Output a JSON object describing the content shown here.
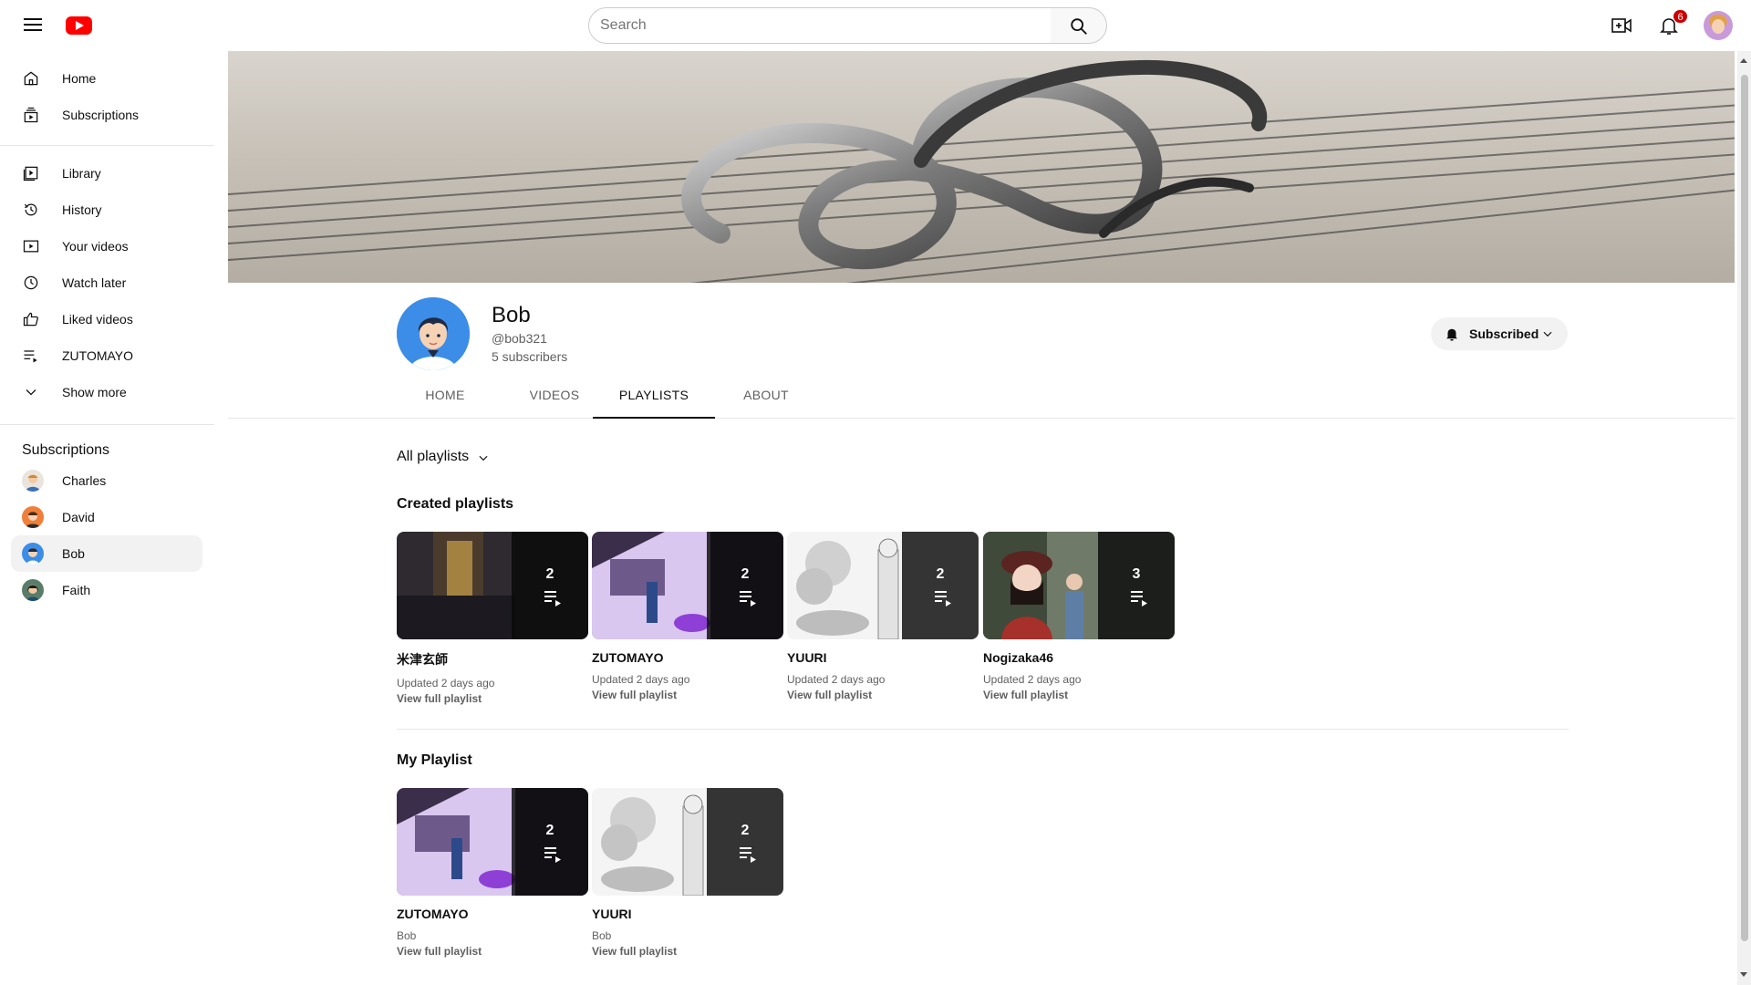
{
  "search": {
    "placeholder": "Search"
  },
  "notifications": {
    "count": "6"
  },
  "sidebar": {
    "main": [
      {
        "label": "Home",
        "icon": "home-icon"
      },
      {
        "label": "Subscriptions",
        "icon": "subscriptions-icon"
      }
    ],
    "library": [
      {
        "label": "Library",
        "icon": "library-icon"
      },
      {
        "label": "History",
        "icon": "history-icon"
      },
      {
        "label": "Your videos",
        "icon": "your-videos-icon"
      },
      {
        "label": "Watch later",
        "icon": "watch-later-icon"
      },
      {
        "label": "Liked videos",
        "icon": "thumbs-up-icon"
      },
      {
        "label": "ZUTOMAYO",
        "icon": "playlist-icon"
      },
      {
        "label": "Show more",
        "icon": "chevron-down-icon"
      }
    ],
    "subscriptions_heading": "Subscriptions",
    "subscriptions": [
      {
        "label": "Charles",
        "active": false
      },
      {
        "label": "David",
        "active": false
      },
      {
        "label": "Bob",
        "active": true
      },
      {
        "label": "Faith",
        "active": false
      }
    ]
  },
  "channel": {
    "name": "Bob",
    "handle": "@bob321",
    "subscribers": "5 subscribers",
    "subscribe_label": "Subscribed"
  },
  "tabs": [
    {
      "label": "HOME",
      "active": false
    },
    {
      "label": "VIDEOS",
      "active": false
    },
    {
      "label": "PLAYLISTS",
      "active": true
    },
    {
      "label": "ABOUT",
      "active": false
    }
  ],
  "filter": {
    "label": "All playlists"
  },
  "sections": [
    {
      "title": "Created playlists",
      "playlists": [
        {
          "title": "米津玄師",
          "count": "2",
          "meta": "Updated 2 days ago",
          "link": "View full playlist"
        },
        {
          "title": "ZUTOMAYO",
          "count": "2",
          "meta": "Updated 2 days ago",
          "link": "View full playlist"
        },
        {
          "title": "YUURI",
          "count": "2",
          "meta": "Updated 2 days ago",
          "link": "View full playlist"
        },
        {
          "title": "Nogizaka46",
          "count": "3",
          "meta": "Updated 2 days ago",
          "link": "View full playlist"
        }
      ]
    },
    {
      "title": "My Playlist",
      "playlists": [
        {
          "title": "ZUTOMAYO",
          "count": "2",
          "meta": "Bob",
          "link": "View full playlist"
        },
        {
          "title": "YUURI",
          "count": "2",
          "meta": "Bob",
          "link": "View full playlist"
        }
      ]
    }
  ]
}
